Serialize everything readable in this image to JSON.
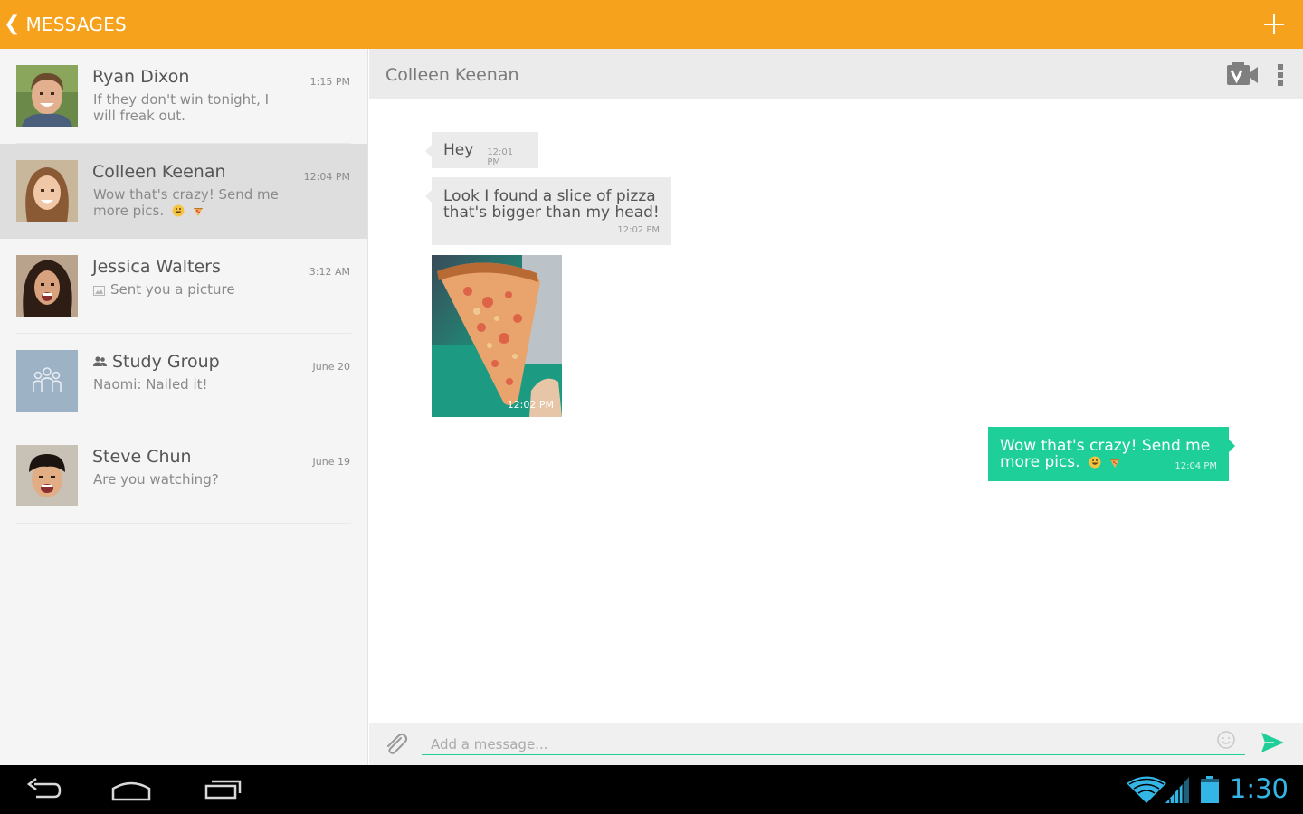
{
  "app": {
    "back_chevron": "❮",
    "title": "MESSAGES"
  },
  "conversations": [
    {
      "name": "Ryan Dixon",
      "time": "1:15 PM",
      "preview": "If they don't win tonight, I will freak out.",
      "selected": false
    },
    {
      "name": "Colleen Keenan",
      "time": "12:04 PM",
      "preview": "Wow that's crazy! Send me more pics.",
      "selected": true
    },
    {
      "name": "Jessica Walters",
      "time": "3:12 AM",
      "preview": "Sent you a picture",
      "selected": false
    },
    {
      "name": "Study Group",
      "time": "June 20",
      "preview": "Naomi: Nailed it!",
      "selected": false,
      "is_group": true
    },
    {
      "name": "Steve Chun",
      "time": "June 19",
      "preview": "Are you watching?",
      "selected": false
    }
  ],
  "chat": {
    "contact_name": "Colleen Keenan",
    "messages": [
      {
        "direction": "incoming",
        "text": "Hey",
        "time": "12:01 PM"
      },
      {
        "direction": "incoming",
        "text": "Look I found a slice of pizza that's bigger than my head!",
        "time": "12:02 PM"
      },
      {
        "direction": "incoming",
        "type": "photo",
        "time": "12:02 PM"
      },
      {
        "direction": "outgoing",
        "text": "Wow that's crazy! Send me more pics.",
        "time": "12:04 PM"
      }
    ]
  },
  "composer": {
    "placeholder": "Add a message..."
  },
  "system": {
    "clock": "1:30"
  },
  "colors": {
    "action_bar": "#f6a21d",
    "outgoing_bubble": "#1fcf9a",
    "incoming_bubble": "#ebebeb",
    "clock": "#33b5e5"
  },
  "icons": [
    "plus-icon",
    "video-call-icon",
    "overflow-menu-icon",
    "attach-icon",
    "smiley-icon",
    "send-icon",
    "group-icon",
    "picture-icon",
    "back-nav-icon",
    "home-nav-icon",
    "recents-nav-icon",
    "wifi-icon",
    "signal-icon",
    "battery-icon"
  ]
}
